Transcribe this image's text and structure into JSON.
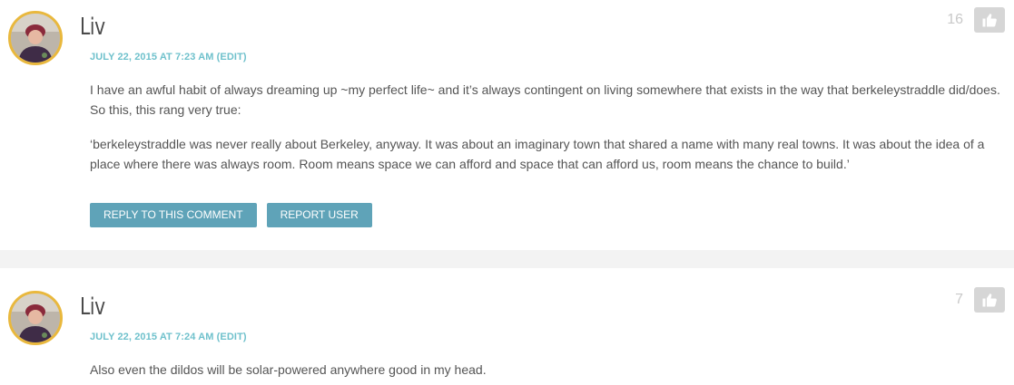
{
  "comments": [
    {
      "author": "Liv",
      "date": "JULY 22, 2015 AT 7:23 AM",
      "edit_label": "(EDIT)",
      "votes": "16",
      "paragraphs": [
        "I have an awful habit of always dreaming up ~my perfect life~ and it’s always contingent on living somewhere that exists in the way that berkeleystraddle did/does. So this, this rang very true:",
        "‘berkeleystraddle was never really about Berkeley, anyway. It was about an imaginary town that shared a name with many real towns. It was about the idea of a place where there was always room. Room means space we can afford and space that can afford us, room means the chance to build.’"
      ],
      "reply_label": "REPLY TO THIS COMMENT",
      "report_label": "REPORT USER"
    },
    {
      "author": "Liv",
      "date": "JULY 22, 2015 AT 7:24 AM",
      "edit_label": "(EDIT)",
      "votes": "7",
      "paragraphs": [
        "Also even the dildos will be solar-powered anywhere good in my head."
      ]
    }
  ],
  "icons": {
    "vote": "thumbs-up-icon",
    "avatar": "user-avatar"
  },
  "colors": {
    "accent": "#6fc1cc",
    "button": "#5fa3b8",
    "avatar_ring": "#e9b83d",
    "divider": "#f3f3f3",
    "vote_button": "#d6d6d6"
  }
}
